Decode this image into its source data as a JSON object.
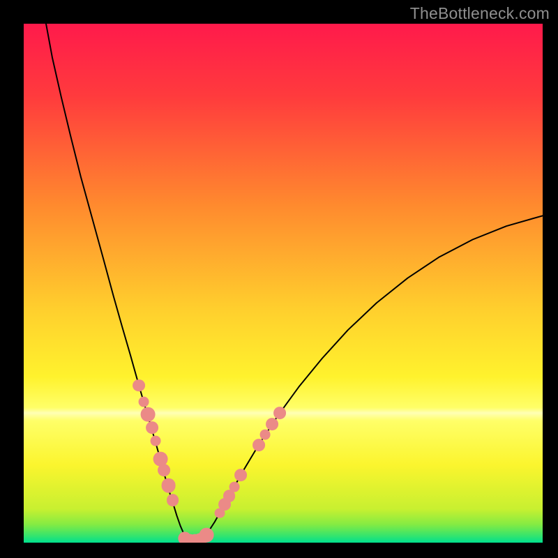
{
  "watermark": {
    "text": "TheBottleneck.com"
  },
  "chart_data": {
    "type": "line",
    "title": "",
    "xlabel": "",
    "ylabel": "",
    "xlim": [
      0,
      100
    ],
    "ylim": [
      0,
      100
    ],
    "grid": false,
    "legend": false,
    "background_gradient_stops": [
      {
        "pct": 0,
        "color": "#ff1a4b"
      },
      {
        "pct": 14,
        "color": "#ff3b3d"
      },
      {
        "pct": 35,
        "color": "#ff8a2e"
      },
      {
        "pct": 55,
        "color": "#ffcf2d"
      },
      {
        "pct": 68,
        "color": "#fff22d"
      },
      {
        "pct": 74,
        "color": "#ffff68"
      },
      {
        "pct": 75,
        "color": "#ffffb5"
      },
      {
        "pct": 76.5,
        "color": "#ffff68"
      },
      {
        "pct": 85,
        "color": "#fbf52e"
      },
      {
        "pct": 93.5,
        "color": "#c8f030"
      },
      {
        "pct": 96.5,
        "color": "#84eb43"
      },
      {
        "pct": 98.5,
        "color": "#3be56a"
      },
      {
        "pct": 100,
        "color": "#00e08e"
      }
    ],
    "series": [
      {
        "name": "bottleneck-curve",
        "x": [
          4.3,
          5.5,
          7.2,
          9.0,
          11.0,
          13.2,
          15.4,
          17.3,
          19.0,
          20.6,
          22.0,
          23.3,
          24.5,
          25.5,
          26.4,
          27.2,
          28.0,
          28.8,
          29.5,
          30.2,
          30.9,
          31.6,
          32.3,
          33.1,
          34.2,
          35.5,
          36.8,
          38.2,
          40.0,
          42.5,
          45.5,
          49.0,
          53.0,
          57.5,
          62.5,
          68.0,
          74.0,
          80.0,
          86.5,
          93.0,
          100.0
        ],
        "y": [
          100.0,
          93.5,
          86.0,
          78.5,
          70.5,
          62.5,
          54.5,
          47.5,
          41.5,
          36.0,
          31.0,
          26.5,
          22.5,
          19.0,
          15.8,
          12.8,
          10.0,
          7.5,
          5.2,
          3.2,
          1.6,
          0.6,
          0.15,
          0.15,
          0.7,
          2.0,
          4.0,
          6.5,
          9.8,
          14.2,
          19.2,
          24.5,
          30.0,
          35.5,
          41.0,
          46.2,
          51.0,
          55.0,
          58.4,
          61.0,
          63.0
        ]
      }
    ],
    "annotations": {
      "dots": [
        {
          "x": 22.2,
          "y": 30.3,
          "r": 1.2
        },
        {
          "x": 23.1,
          "y": 27.2,
          "r": 1.0
        },
        {
          "x": 23.9,
          "y": 24.7,
          "r": 1.4
        },
        {
          "x": 24.7,
          "y": 22.2,
          "r": 1.2
        },
        {
          "x": 25.4,
          "y": 19.6,
          "r": 1.0
        },
        {
          "x": 26.4,
          "y": 16.1,
          "r": 1.4
        },
        {
          "x": 27.0,
          "y": 14.0,
          "r": 1.2
        },
        {
          "x": 27.9,
          "y": 11.0,
          "r": 1.4
        },
        {
          "x": 28.7,
          "y": 8.2,
          "r": 1.2
        },
        {
          "x": 31.0,
          "y": 0.8,
          "r": 1.3
        },
        {
          "x": 32.0,
          "y": 0.3,
          "r": 1.4
        },
        {
          "x": 33.0,
          "y": 0.3,
          "r": 1.4
        },
        {
          "x": 34.0,
          "y": 0.5,
          "r": 1.3
        },
        {
          "x": 35.2,
          "y": 1.5,
          "r": 1.4
        },
        {
          "x": 37.8,
          "y": 5.7,
          "r": 1.0
        },
        {
          "x": 38.7,
          "y": 7.4,
          "r": 1.2
        },
        {
          "x": 39.6,
          "y": 9.0,
          "r": 1.2
        },
        {
          "x": 40.6,
          "y": 10.8,
          "r": 1.0
        },
        {
          "x": 41.8,
          "y": 13.0,
          "r": 1.2
        },
        {
          "x": 45.3,
          "y": 18.8,
          "r": 1.2
        },
        {
          "x": 46.5,
          "y": 20.8,
          "r": 1.0
        },
        {
          "x": 47.9,
          "y": 22.8,
          "r": 1.2
        },
        {
          "x": 49.3,
          "y": 25.0,
          "r": 1.2
        }
      ]
    }
  }
}
